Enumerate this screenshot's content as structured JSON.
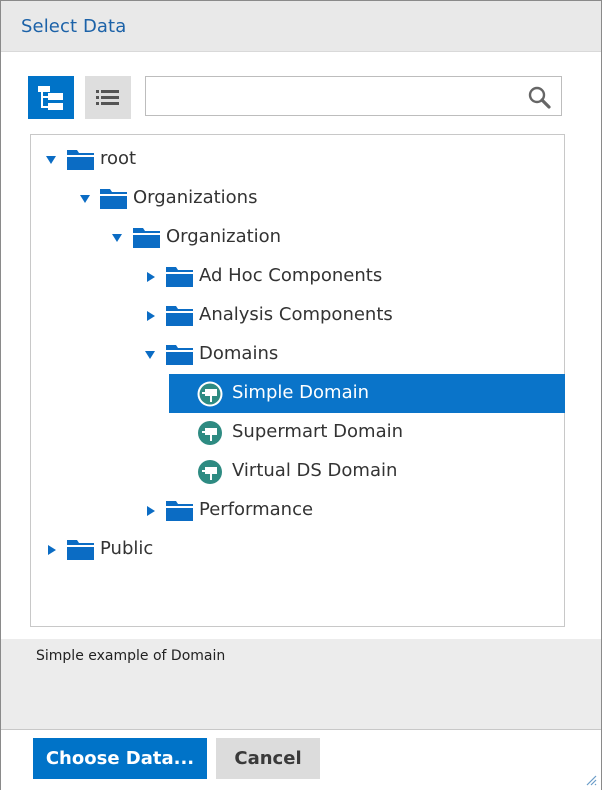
{
  "dialog": {
    "title": "Select Data"
  },
  "toolbar": {
    "tree_view_icon": "tree-view-icon",
    "list_view_icon": "list-view-icon",
    "search_value": "",
    "search_placeholder": ""
  },
  "tree": {
    "nodes": [
      {
        "label": "root",
        "type": "folder",
        "expanded": true,
        "level": 0
      },
      {
        "label": "Organizations",
        "type": "folder",
        "expanded": true,
        "level": 1
      },
      {
        "label": "Organization",
        "type": "folder",
        "expanded": true,
        "level": 2
      },
      {
        "label": "Ad Hoc Components",
        "type": "folder",
        "expanded": false,
        "level": 3
      },
      {
        "label": "Analysis Components",
        "type": "folder",
        "expanded": false,
        "level": 3
      },
      {
        "label": "Domains",
        "type": "folder",
        "expanded": true,
        "level": 3
      },
      {
        "label": "Simple Domain",
        "type": "domain",
        "selected": true,
        "level": 4
      },
      {
        "label": "Supermart Domain",
        "type": "domain",
        "level": 4
      },
      {
        "label": "Virtual DS Domain",
        "type": "domain",
        "level": 4
      },
      {
        "label": "Performance",
        "type": "folder",
        "expanded": false,
        "level": 3
      },
      {
        "label": "Public",
        "type": "folder",
        "expanded": false,
        "level": 0
      }
    ]
  },
  "description": {
    "text": "Simple example of Domain"
  },
  "footer": {
    "choose_label": "Choose Data...",
    "cancel_label": "Cancel"
  },
  "colors": {
    "accent": "#0073c8",
    "title": "#1c62a8",
    "domain_icon": "#2e8b82"
  }
}
